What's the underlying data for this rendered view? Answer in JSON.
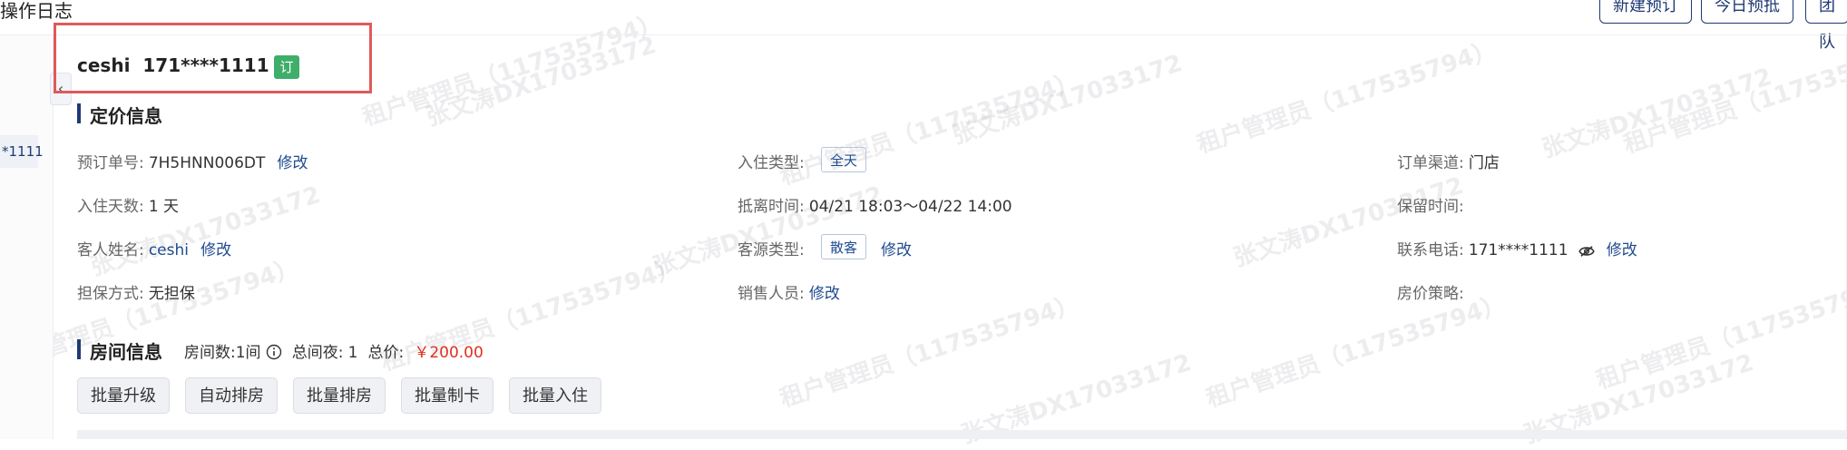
{
  "header": {
    "title": "操作日志",
    "buttons": {
      "new_booking": "新建预订",
      "today_arrival": "今日预抵",
      "team": "团队"
    }
  },
  "left_rail": {
    "tag": "*1111"
  },
  "guest": {
    "name": "ceshi",
    "phone": "171****1111",
    "badge": "订"
  },
  "pricing": {
    "title": "定价信息",
    "booking_no": {
      "label": "预订单号:",
      "value": "7H5HNN006DT",
      "action": "修改"
    },
    "checkin_type": {
      "label": "入住类型:",
      "tag": "全天"
    },
    "channel": {
      "label": "订单渠道:",
      "value": "门店"
    },
    "nights": {
      "label": "入住天数:",
      "value": "1 天"
    },
    "arrive_depart": {
      "label": "抵离时间:",
      "value": "04/21 18:03～04/22 14:00"
    },
    "hold_time": {
      "label": "保留时间:",
      "value": ""
    },
    "guest_name": {
      "label": "客人姓名:",
      "value": "ceshi",
      "action": "修改"
    },
    "source_type": {
      "label": "客源类型:",
      "tag": "散客",
      "action": "修改"
    },
    "contact_phone": {
      "label": "联系电话:",
      "value": "171****1111",
      "action": "修改"
    },
    "guarantee": {
      "label": "担保方式:",
      "value": "无担保"
    },
    "sales": {
      "label": "销售人员:",
      "action": "修改"
    },
    "rate_policy": {
      "label": "房价策略:",
      "value": ""
    }
  },
  "rooms": {
    "title": "房间信息",
    "room_count_label": "房间数:",
    "room_count": "1间",
    "nights_label": "总间夜:",
    "nights": "1",
    "total_label": "总价:",
    "total": "￥200.00",
    "batch_buttons": [
      "批量升级",
      "自动排房",
      "批量排房",
      "批量制卡",
      "批量入住"
    ]
  },
  "watermark": {
    "primary": "租户管理员（117535794）",
    "secondary": "张文涛DX17033172"
  },
  "colors": {
    "accent": "#1f3a73",
    "link": "#1f4b8f",
    "price": "#e0301e",
    "badge": "#3fae6a",
    "highlight": "#e05a5a"
  }
}
